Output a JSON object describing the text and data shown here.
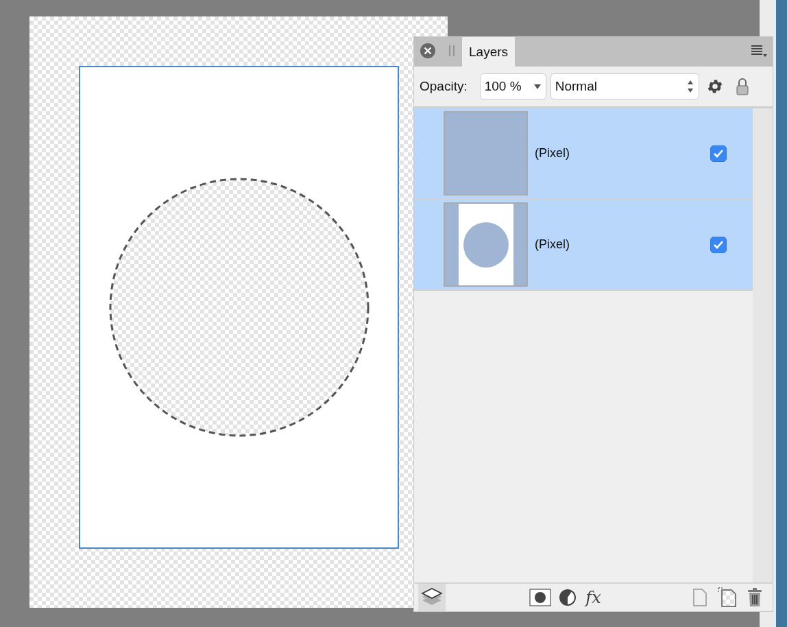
{
  "layers_panel": {
    "tabs": [
      {
        "label": "Layers",
        "selected": true
      }
    ],
    "opacity_label": "Opacity:",
    "opacity": "100 %",
    "blend_mode": "Normal",
    "layers": [
      {
        "name": "(Pixel)",
        "kind": "fill",
        "selected": true,
        "visible": true
      },
      {
        "name": "(Pixel)",
        "kind": "document",
        "selected": true,
        "visible": true
      }
    ],
    "fx_label": "fx"
  }
}
